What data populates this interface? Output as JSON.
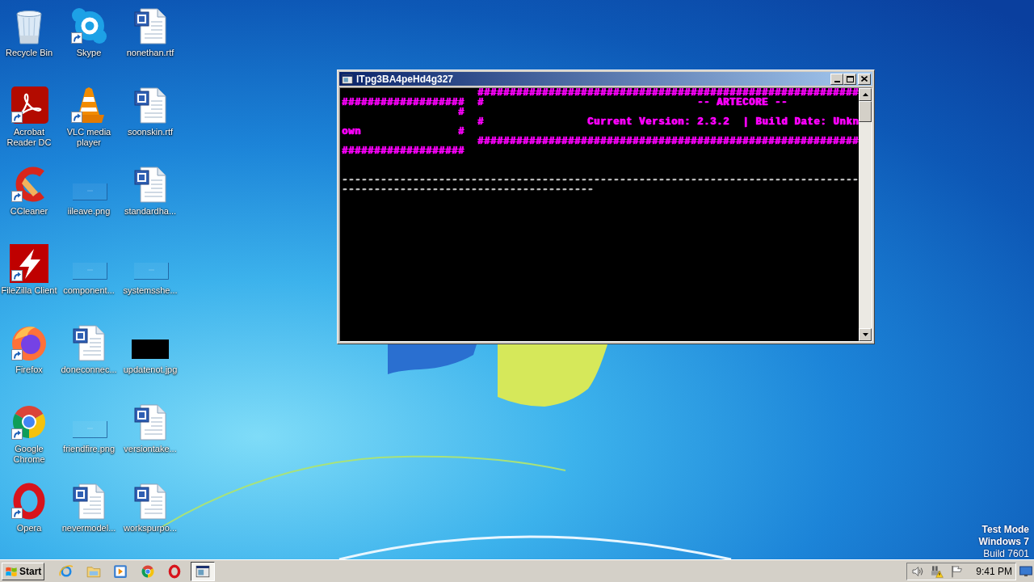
{
  "desktop": {
    "icons": [
      {
        "label": "Recycle Bin",
        "kind": "recycle-bin",
        "shortcut": false
      },
      {
        "label": "Skype",
        "kind": "skype",
        "shortcut": true
      },
      {
        "label": "nonethan.rtf",
        "kind": "word-doc",
        "shortcut": false
      },
      {
        "label": "Acrobat Reader DC",
        "kind": "acrobat",
        "shortcut": true
      },
      {
        "label": "VLC media player",
        "kind": "vlc",
        "shortcut": true
      },
      {
        "label": "soonskin.rtf",
        "kind": "word-doc",
        "shortcut": false
      },
      {
        "label": "CCleaner",
        "kind": "ccleaner",
        "shortcut": true
      },
      {
        "label": "iileave.png",
        "kind": "blank-image",
        "shortcut": false
      },
      {
        "label": "standardha...",
        "kind": "word-doc",
        "shortcut": false
      },
      {
        "label": "FileZilla Client",
        "kind": "filezilla",
        "shortcut": true
      },
      {
        "label": "component...",
        "kind": "blank-image",
        "shortcut": false
      },
      {
        "label": "systemsshe...",
        "kind": "blank-image",
        "shortcut": false
      },
      {
        "label": "Firefox",
        "kind": "firefox",
        "shortcut": true
      },
      {
        "label": "doneconnec...",
        "kind": "word-doc",
        "shortcut": false
      },
      {
        "label": "updatenot.jpg",
        "kind": "black-image",
        "shortcut": false
      },
      {
        "label": "Google Chrome",
        "kind": "chrome",
        "shortcut": true
      },
      {
        "label": "friendfire.png",
        "kind": "blank-image",
        "shortcut": false
      },
      {
        "label": "versiontake...",
        "kind": "word-doc",
        "shortcut": false
      },
      {
        "label": "Opera",
        "kind": "opera",
        "shortcut": true
      },
      {
        "label": "nevermodel...",
        "kind": "word-doc",
        "shortcut": false
      },
      {
        "label": "workspurpo...",
        "kind": "word-doc",
        "shortcut": false
      }
    ]
  },
  "console_window": {
    "title": "lTpg3BA4peHd4g327",
    "lines": [
      {
        "kind": "banner",
        "text": "                     ###########################################################"
      },
      {
        "kind": "banner",
        "text": "###################  #                                 -- ARTECORE --"
      },
      {
        "kind": "banner",
        "text": "                  #"
      },
      {
        "kind": "banner",
        "text": "                     #                Current Version: 2.3.2  | Build Date: Unkn"
      },
      {
        "kind": "banner",
        "text": "own               #"
      },
      {
        "kind": "banner",
        "text": "                     ###########################################################"
      },
      {
        "kind": "banner",
        "text": "###################"
      },
      {
        "kind": "blank"
      },
      {
        "kind": "blank"
      },
      {
        "kind": "rule",
        "text": "--------------------------------------------------------------------------------"
      },
      {
        "kind": "rule",
        "text": "---------------------------------------"
      }
    ]
  },
  "system_notice": [
    {
      "text": "Test Mode",
      "bold": true
    },
    {
      "text": "Windows 7",
      "bold": true
    },
    {
      "text": "Build 7601",
      "bold": false
    }
  ],
  "taskbar": {
    "start": "Start",
    "quick_launch": [
      {
        "kind": "ie"
      },
      {
        "kind": "explorer"
      },
      {
        "kind": "media-player"
      },
      {
        "kind": "chrome"
      },
      {
        "kind": "opera"
      }
    ],
    "tasks": [
      {
        "kind": "console",
        "selected": true
      }
    ],
    "tray_icons": [
      {
        "kind": "speaker"
      },
      {
        "kind": "network-warning"
      },
      {
        "kind": "flag"
      }
    ],
    "clock": "9:41 PM"
  }
}
